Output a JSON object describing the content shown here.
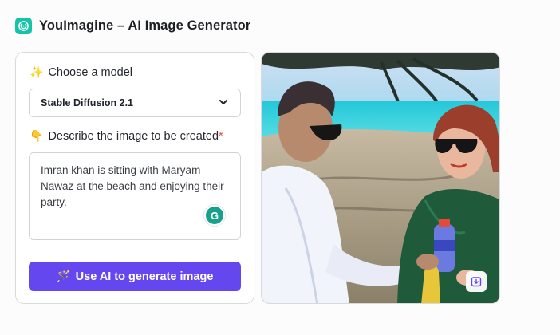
{
  "app": {
    "title": "YouImagine – AI Image Generator",
    "logo_icon": "spiral-logo-icon",
    "accent_color": "#6547f0",
    "logo_color": "#14c4a8"
  },
  "form": {
    "model_label_emoji": "✨",
    "model_label": "Choose a model",
    "model_selected": "Stable Diffusion 2.1",
    "prompt_label_emoji": "👇",
    "prompt_label": "Describe the image to be created",
    "required_mark": "*",
    "prompt_value": "Imran khan is sitting with Maryam Nawaz at the beach and enjoying their party.",
    "grammarly_letter": "G",
    "generate_emoji": "🪄",
    "generate_label": "Use AI to generate image"
  },
  "result": {
    "image_description_icon": "generated-image",
    "download_icon": "download-icon"
  }
}
